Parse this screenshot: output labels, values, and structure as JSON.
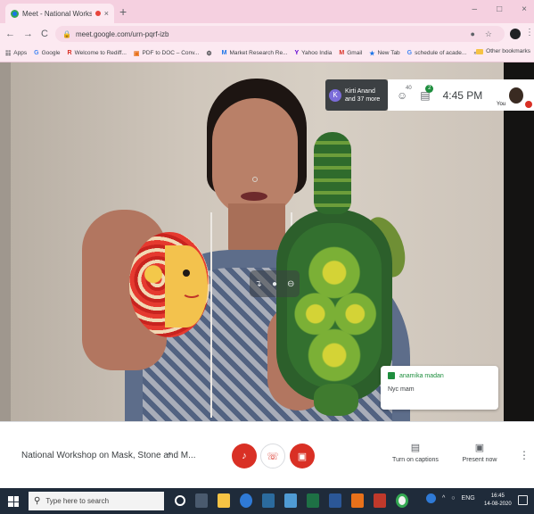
{
  "browser": {
    "tab_title": "Meet - National Worksho...",
    "tab_close": "×",
    "new_tab": "+",
    "window_controls": [
      "–",
      "□",
      "×"
    ],
    "nav": [
      "←",
      "→",
      "C"
    ],
    "url": "meet.google.com/urn-pqrf-izb",
    "bookmarks": [
      {
        "icon": "☷",
        "label": "Apps"
      },
      {
        "icon": "G",
        "label": "Google"
      },
      {
        "icon": "R",
        "label": "Welcome to Rediff..."
      },
      {
        "icon": "▣",
        "label": "PDF to DOC – Conv..."
      },
      {
        "icon": "⚙",
        "label": ""
      },
      {
        "icon": "M",
        "label": "Market Research Re..."
      },
      {
        "icon": "Y",
        "label": "Yahoo India"
      },
      {
        "icon": "M",
        "label": "Gmail"
      },
      {
        "icon": "★",
        "label": "New Tab"
      },
      {
        "icon": "G",
        "label": "schedule of acade..."
      }
    ],
    "bookmarks_more": "»",
    "other_bookmarks": "Other bookmarks"
  },
  "meet": {
    "participant_initial": "K",
    "participant_line1": "Kirti Anand",
    "participant_line2": "and 37 more",
    "people_count": "40",
    "chat_badge": "2",
    "time": "4:45 PM",
    "you_label": "You",
    "chat": {
      "sender": "anamika madan",
      "message": "Nyc mam"
    },
    "meeting_title": "National Workshop on Mask, Stone and M...",
    "meeting_chevron": "^",
    "captions_label": "Turn on captions",
    "present_label": "Present now",
    "more": "⋮"
  },
  "taskbar": {
    "search_placeholder": "Type here to search",
    "tray_lang": "ENG",
    "clock_time": "16:45",
    "clock_date": "14-08-2020"
  },
  "colors": {
    "tabstrip": "#f5d0e0",
    "toolbar": "#fce9f1",
    "meet_red": "#d93025",
    "meet_green": "#1e8e3e",
    "taskbar": "#1f2b3a"
  }
}
